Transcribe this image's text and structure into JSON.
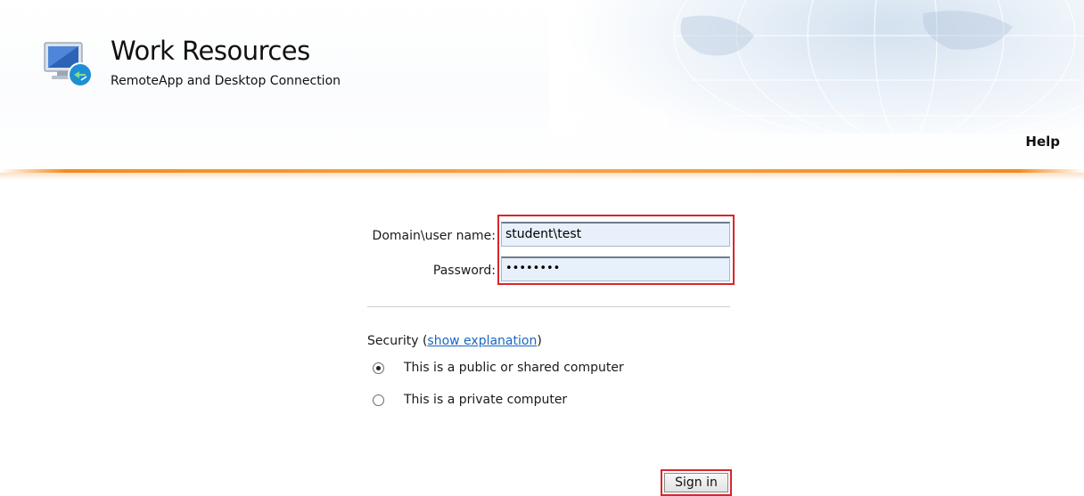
{
  "header": {
    "title": "Work Resources",
    "subtitle": "RemoteApp and Desktop Connection",
    "help_label": "Help"
  },
  "form": {
    "username_label": "Domain\\user name:",
    "username_value": "student\\test",
    "password_label": "Password:",
    "password_value": "••••••••",
    "security_prefix": "Security (",
    "security_link": "show explanation",
    "security_suffix": ")",
    "options": [
      {
        "label": "This is a public or shared computer",
        "selected": true
      },
      {
        "label": "This is a private computer",
        "selected": false
      }
    ],
    "signin_label": "Sign in"
  },
  "colors": {
    "accent_orange": "#f28c1e",
    "highlight_red": "#d8262c",
    "link_blue": "#1a66c2",
    "input_bg": "#e8f0fb"
  },
  "icons": {
    "logo": "remote-desktop-monitor-icon"
  }
}
